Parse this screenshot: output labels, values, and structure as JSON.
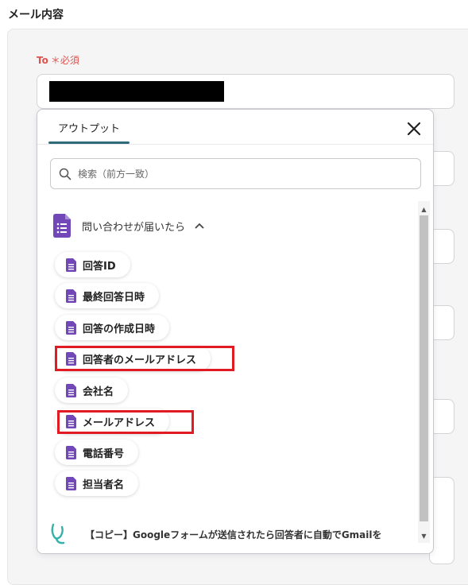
{
  "section": {
    "title": "メール内容"
  },
  "to_field": {
    "label": "To",
    "required_mark": "＊必須",
    "value": ""
  },
  "popup": {
    "tab_label": "アウトプット",
    "search": {
      "placeholder": "検索（前方一致）",
      "value": ""
    },
    "group": {
      "title": "問い合わせが届いたら",
      "expanded": true,
      "items": [
        {
          "label": "回答ID",
          "highlighted": false
        },
        {
          "label": "最終回答日時",
          "highlighted": false
        },
        {
          "label": "回答の作成日時",
          "highlighted": false
        },
        {
          "label": "回答者のメールアドレス",
          "highlighted": true
        },
        {
          "label": "会社名",
          "highlighted": false
        },
        {
          "label": "メールアドレス",
          "highlighted": true
        },
        {
          "label": "電話番号",
          "highlighted": false
        },
        {
          "label": "担当者名",
          "highlighted": false
        }
      ]
    },
    "flow_label": "【コピー】Googleフォームが送信されたら回答者に自動でGmailを"
  },
  "colors": {
    "required": "#e0524c",
    "tab_accent": "#2f6b7a",
    "forms_purple": "#7248b9",
    "highlight_red": "#e01b24",
    "flow_logo": "#35b2a8"
  },
  "icons": {
    "close": "close-icon",
    "search": "search-icon",
    "form": "google-forms-icon",
    "chevron": "chevron-up-icon",
    "logo": "yoom-logo-icon"
  }
}
